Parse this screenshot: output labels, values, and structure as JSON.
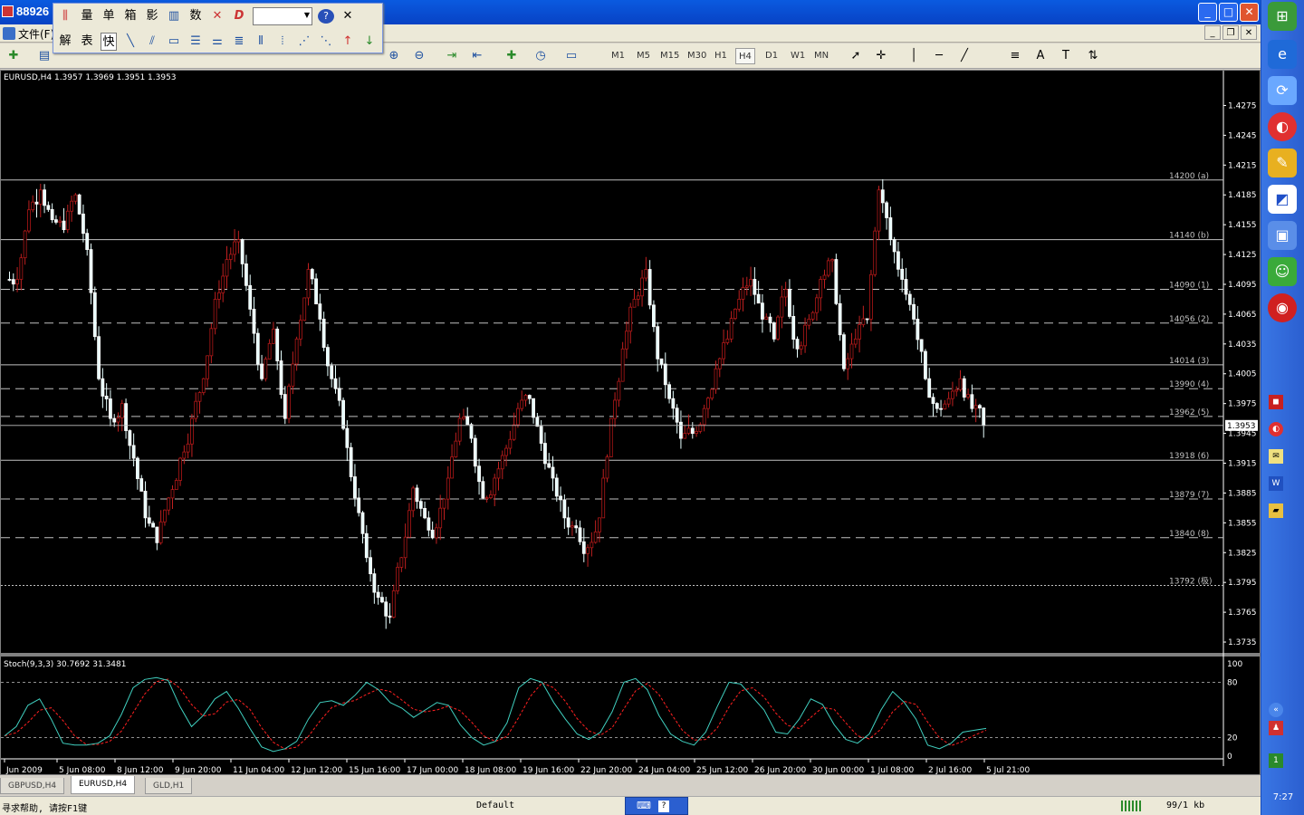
{
  "window": {
    "title": "88926",
    "buttons": [
      "_",
      "□",
      "✕"
    ]
  },
  "menu": {
    "file": "文件(F)"
  },
  "floating_toolbar": {
    "row1": [
      "量",
      "单",
      "箱",
      "影",
      "数"
    ],
    "row2": [
      "解",
      "表",
      "快"
    ]
  },
  "timeframes": [
    "M1",
    "M5",
    "M15",
    "M30",
    "H1",
    "H4",
    "D1",
    "W1",
    "MN"
  ],
  "active_timeframe": "H4",
  "chart_info": "EURUSD,H4  1.3957 1.3969 1.3951 1.3953",
  "current_price": "1.3953",
  "price_axis": [
    "1.4275",
    "1.4245",
    "1.4215",
    "1.4185",
    "1.4155",
    "1.4125",
    "1.4095",
    "1.4065",
    "1.4035",
    "1.4005",
    "1.3975",
    "1.3945",
    "1.3915",
    "1.3885",
    "1.3855",
    "1.3825",
    "1.3795",
    "1.3765",
    "1.3735"
  ],
  "levels": [
    {
      "label": "14200 (a)",
      "price": 1.42,
      "style": "solid"
    },
    {
      "label": "14140 (b)",
      "price": 1.414,
      "style": "solid"
    },
    {
      "label": "14090 (1)",
      "price": 1.409,
      "style": "dash"
    },
    {
      "label": "14056 (2)",
      "price": 1.4056,
      "style": "dash"
    },
    {
      "label": "14014 (3)",
      "price": 1.4014,
      "style": "solid"
    },
    {
      "label": "13990 (4)",
      "price": 1.399,
      "style": "dash"
    },
    {
      "label": "13962 (5)",
      "price": 1.3962,
      "style": "dash"
    },
    {
      "label": "13918 (6)",
      "price": 1.3918,
      "style": "solid"
    },
    {
      "label": "13879 (7)",
      "price": 1.3879,
      "style": "dash"
    },
    {
      "label": "13840 (8)",
      "price": 1.384,
      "style": "dash"
    },
    {
      "label": "13792 (极)",
      "price": 1.3792,
      "style": "dot"
    }
  ],
  "time_axis": [
    "Jun 2009",
    "5 Jun 08:00",
    "8 Jun 12:00",
    "9 Jun 20:00",
    "11 Jun 04:00",
    "12 Jun 12:00",
    "15 Jun 16:00",
    "17 Jun 00:00",
    "18 Jun 08:00",
    "19 Jun 16:00",
    "22 Jun 20:00",
    "24 Jun 04:00",
    "25 Jun 12:00",
    "26 Jun 20:00",
    "30 Jun 00:00",
    "1 Jul 08:00",
    "2 Jul 16:00",
    "5 Jul 21:00"
  ],
  "stoch_info": "Stoch(9,3,3) 30.7692 31.3481",
  "stoch_axis": [
    "100",
    "80",
    "20",
    "0"
  ],
  "chart_data": {
    "type": "candlestick",
    "symbol": "EURUSD",
    "timeframe": "H4",
    "ylim": [
      1.3725,
      1.429
    ],
    "close_path": [
      1.41,
      1.417,
      1.419,
      1.416,
      1.415,
      1.4185,
      1.413,
      1.4,
      1.396,
      1.3975,
      1.392,
      1.386,
      1.3835,
      1.388,
      1.392,
      1.396,
      1.4,
      1.408,
      1.412,
      1.414,
      1.407,
      1.4,
      1.405,
      1.396,
      1.404,
      1.411,
      1.406,
      1.4,
      1.395,
      1.388,
      1.382,
      1.378,
      1.376,
      1.382,
      1.389,
      1.386,
      1.385,
      1.39,
      1.396,
      1.394,
      1.388,
      1.39,
      1.393,
      1.397,
      1.398,
      1.3935,
      1.39,
      1.386,
      1.385,
      1.383,
      1.386,
      1.396,
      1.403,
      1.408,
      1.411,
      1.402,
      1.398,
      1.394,
      1.3945,
      1.397,
      1.401,
      1.404,
      1.408,
      1.41,
      1.406,
      1.404,
      1.409,
      1.403,
      1.406,
      1.41,
      1.412,
      1.401,
      1.404,
      1.406,
      1.419,
      1.414,
      1.41,
      1.406,
      1.4,
      1.397,
      1.398,
      1.4,
      1.397,
      1.3953
    ],
    "stoch_k": [
      22,
      32,
      55,
      62,
      40,
      14,
      12,
      12,
      14,
      22,
      45,
      74,
      83,
      85,
      82,
      54,
      32,
      44,
      62,
      70,
      52,
      30,
      10,
      5,
      8,
      16,
      40,
      58,
      60,
      55,
      66,
      80,
      72,
      58,
      52,
      42,
      50,
      58,
      55,
      34,
      20,
      12,
      16,
      36,
      74,
      84,
      80,
      58,
      40,
      24,
      18,
      26,
      48,
      80,
      84,
      72,
      44,
      24,
      16,
      12,
      26,
      54,
      80,
      78,
      64,
      50,
      26,
      24,
      40,
      62,
      56,
      34,
      18,
      14,
      24,
      50,
      70,
      58,
      40,
      12,
      8,
      14,
      26,
      28,
      30
    ]
  }
}
